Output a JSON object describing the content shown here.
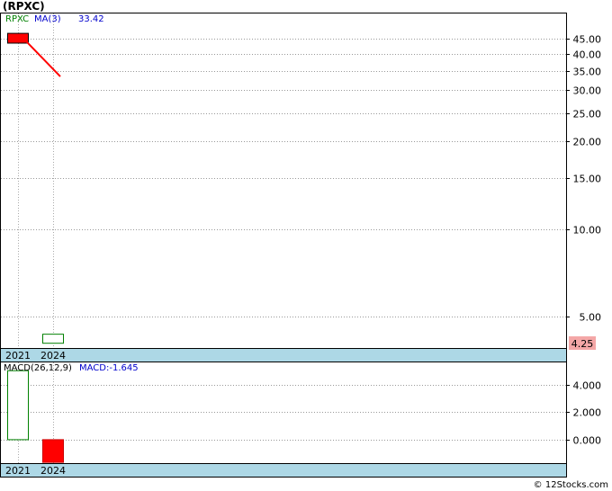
{
  "title": "(RPXC)",
  "watermark": "© 12Stocks.com",
  "chart_data": [
    {
      "type": "candlestick",
      "ticker_label": "RPXC",
      "ma_label": "MA(3)",
      "ma_value": "33.42",
      "scale": "log",
      "ylim": [
        3.9,
        55
      ],
      "y_ticks": [
        45,
        40,
        35,
        30,
        25,
        20,
        15,
        10,
        5
      ],
      "y_tick_labels": [
        "45.00",
        "40.00",
        "35.00",
        "30.00",
        "25.00",
        "20.00",
        "15.00",
        "10.00",
        "5.00"
      ],
      "x_tick_labels": [
        "2021",
        "2024"
      ],
      "last_price_label": "4.25",
      "candles": [
        {
          "period": "2021",
          "open": 47.0,
          "close": 43.5,
          "high": 47.0,
          "low": 43.5,
          "direction": "down"
        },
        {
          "period": "2024",
          "open": 4.05,
          "close": 4.35,
          "high": 4.35,
          "low": 4.05,
          "direction": "up"
        }
      ],
      "ma_line": [
        {
          "period": "2021",
          "value": 44.5
        },
        {
          "period": "2024",
          "value": 33.42
        }
      ],
      "colors": {
        "down": "#ff0000",
        "up": "#ffffff",
        "up_border": "#008000",
        "ma": "#ff0000",
        "ticker": "#008000",
        "ma_text": "#0000cc"
      }
    },
    {
      "type": "bar",
      "label": "MACD(26,12,9)",
      "macd_label": "MACD:-1.645",
      "ylim": [
        -1.7,
        5.6
      ],
      "y_ticks": [
        4,
        2,
        0
      ],
      "y_tick_labels": [
        "4.000",
        "2.000",
        "0.000"
      ],
      "x_tick_labels": [
        "2021",
        "2024"
      ],
      "bars": [
        {
          "period": "2021",
          "value": 5.0,
          "color": "#ffffff",
          "border": "#008000"
        },
        {
          "period": "2024",
          "value": -1.645,
          "color": "#ff0000",
          "border": "#cc0000"
        }
      ]
    }
  ]
}
